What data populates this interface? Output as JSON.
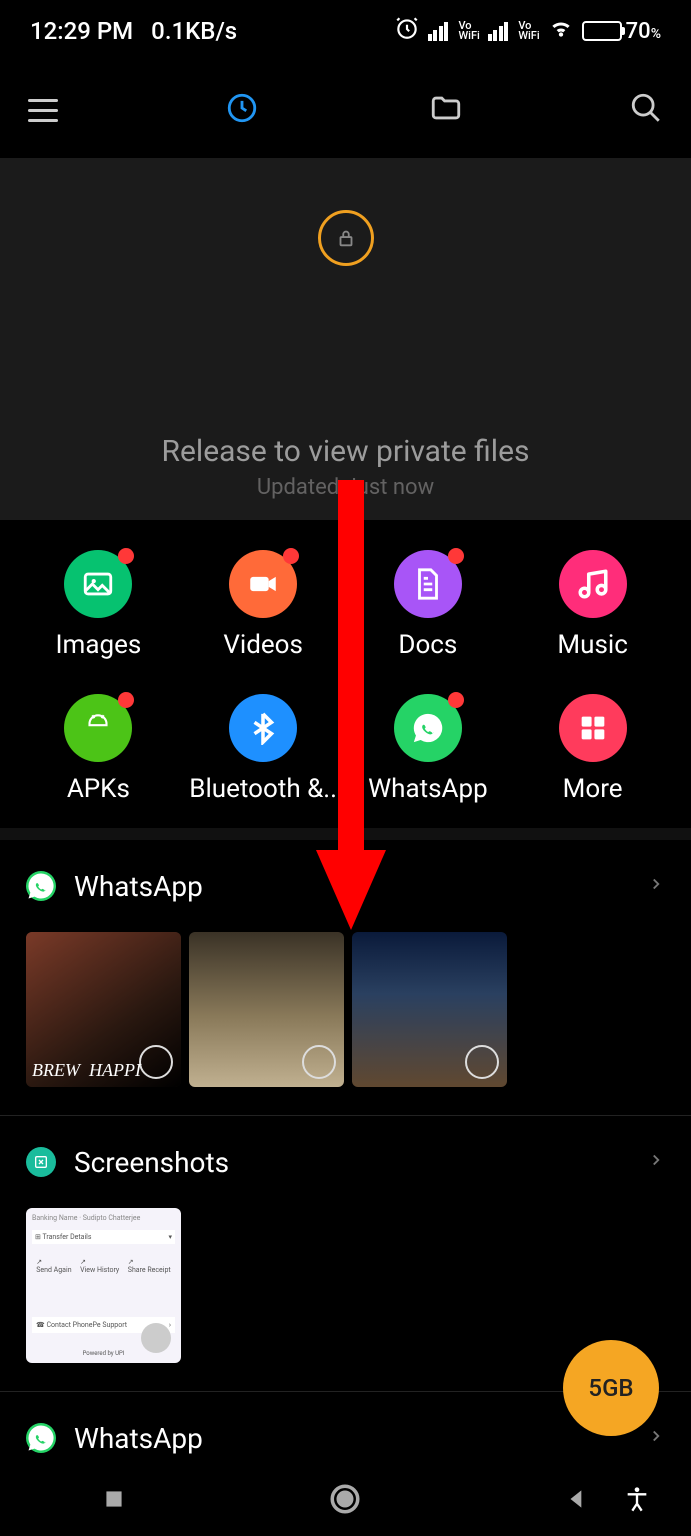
{
  "status": {
    "time": "12:29 PM",
    "net_speed": "0.1KB/s",
    "vowifi": "Vo WiFi",
    "battery_pct": "70",
    "battery_pct_sym": "%"
  },
  "pull": {
    "title": "Release to view private files",
    "subtitle": "Updated Just now"
  },
  "categories": [
    {
      "label": "Images",
      "color": "#06c270",
      "badge": true,
      "icon": "image"
    },
    {
      "label": "Videos",
      "color": "#ff6a39",
      "badge": true,
      "icon": "video"
    },
    {
      "label": "Docs",
      "color": "#a855f7",
      "badge": true,
      "icon": "doc"
    },
    {
      "label": "Music",
      "color": "#ff2d7a",
      "badge": false,
      "icon": "music"
    },
    {
      "label": "APKs",
      "color": "#4cc417",
      "badge": true,
      "icon": "android"
    },
    {
      "label": "Bluetooth &..",
      "color": "#1e90ff",
      "badge": false,
      "icon": "bluetooth"
    },
    {
      "label": "WhatsApp",
      "color": "#25d366",
      "badge": true,
      "icon": "whatsapp"
    },
    {
      "label": "More",
      "color": "#ff3b5c",
      "badge": false,
      "icon": "grid"
    }
  ],
  "sections": [
    {
      "title": "WhatsApp",
      "badge_color": "#25d366",
      "icon": "whatsapp",
      "thumb_count": 3,
      "type": "photos"
    },
    {
      "title": "Screenshots",
      "badge_color": "#1abc9c",
      "icon": "screenshot",
      "thumb_count": 1,
      "type": "screenshot"
    },
    {
      "title": "WhatsApp",
      "badge_color": "#25d366",
      "icon": "whatsapp",
      "thumb_count": 0,
      "type": "photos"
    }
  ],
  "screenshot_thumb": {
    "header": "Banking Name · Sudipto Chatterjee",
    "row1": "Transfer Details",
    "actions": [
      "Send Again",
      "View History",
      "Share Receipt"
    ],
    "support": "Contact PhonePe Support",
    "footer": "Powered by UPI"
  },
  "fab": {
    "label": "5GB"
  }
}
